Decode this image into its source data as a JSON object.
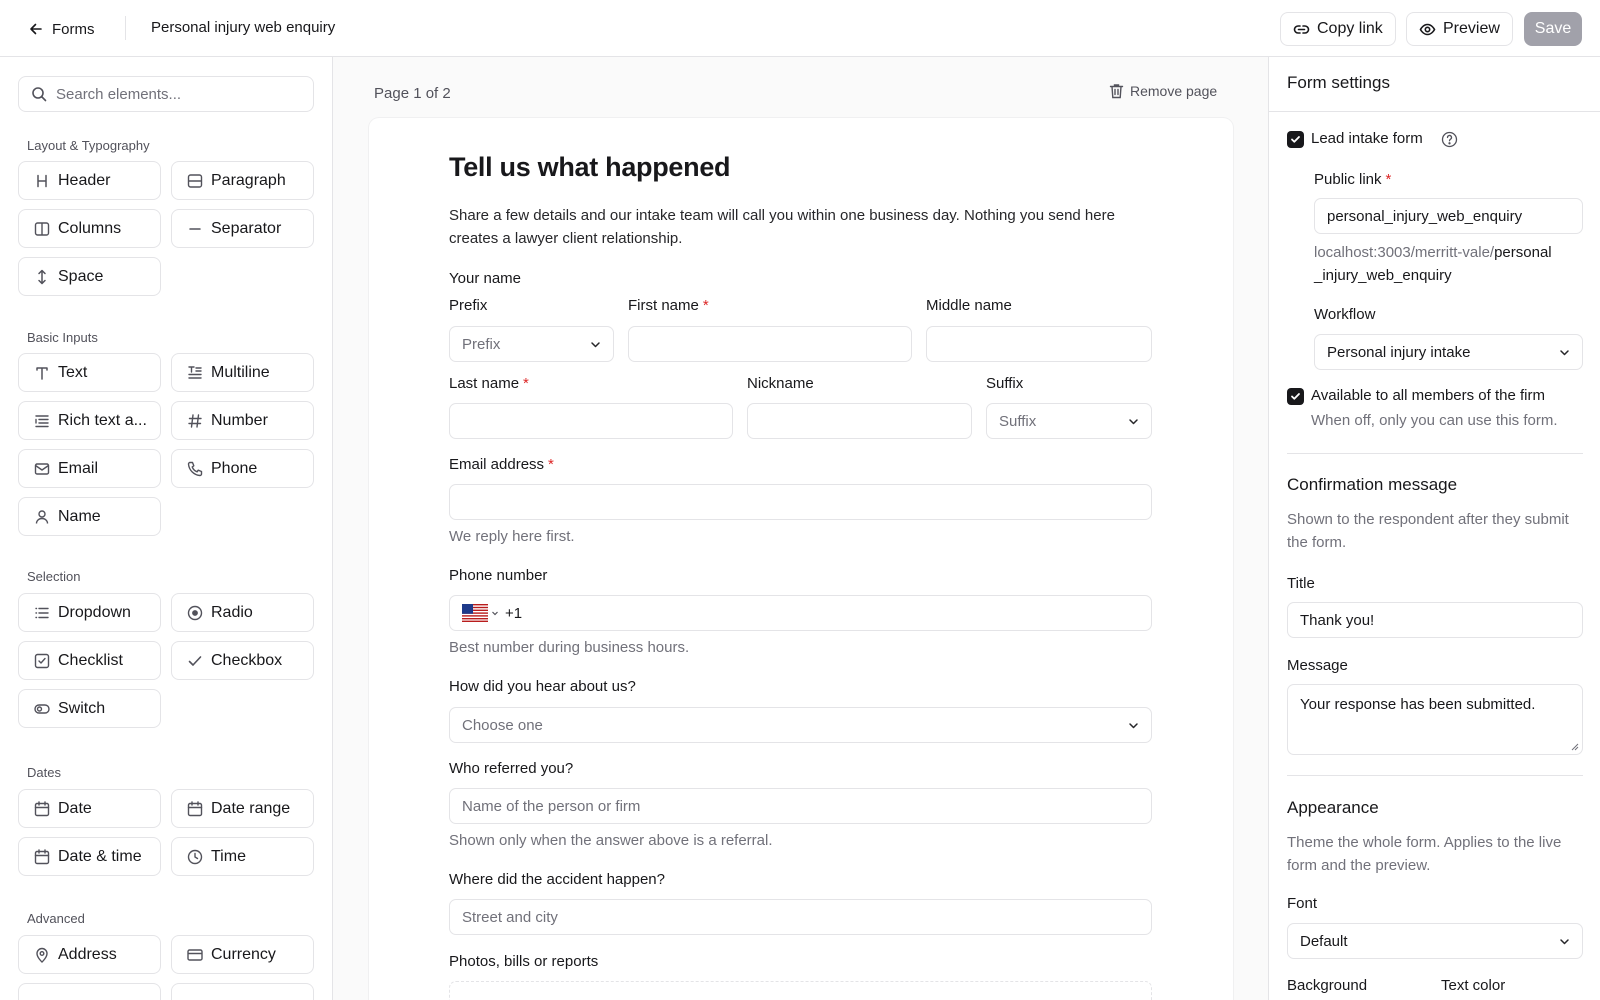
{
  "header": {
    "back_label": "Forms",
    "title": "Personal injury web enquiry",
    "copy_link_label": "Copy link",
    "preview_label": "Preview",
    "save_label": "Save"
  },
  "sidebar": {
    "search_placeholder": "Search elements...",
    "sections": {
      "layout": "Layout & Typography",
      "basic": "Basic Inputs",
      "selection": "Selection",
      "dates": "Dates",
      "advanced": "Advanced"
    },
    "elements": {
      "header": "Header",
      "paragraph": "Paragraph",
      "columns": "Columns",
      "separator": "Separator",
      "space": "Space",
      "text": "Text",
      "multiline": "Multiline",
      "rich_text": "Rich text a...",
      "number": "Number",
      "email": "Email",
      "phone": "Phone",
      "name": "Name",
      "dropdown": "Dropdown",
      "radio": "Radio",
      "checklist": "Checklist",
      "checkbox": "Checkbox",
      "switch": "Switch",
      "date": "Date",
      "date_range": "Date range",
      "date_time": "Date & time",
      "time": "Time",
      "address": "Address",
      "currency": "Currency"
    }
  },
  "canvas": {
    "page_indicator": "Page 1 of 2",
    "remove_page_label": "Remove page",
    "form": {
      "title": "Tell us what happened",
      "description": "Share a few details and our intake team will call you within one business day. Nothing you send here creates a lawyer client relationship.",
      "your_name_label": "Your name",
      "prefix_label": "Prefix",
      "prefix_placeholder": "Prefix",
      "first_name_label": "First name",
      "middle_name_label": "Middle name",
      "last_name_label": "Last name",
      "nickname_label": "Nickname",
      "suffix_label": "Suffix",
      "suffix_placeholder": "Suffix",
      "email_label": "Email address",
      "email_help": "We reply here first.",
      "phone_label": "Phone number",
      "phone_code": "+1",
      "phone_help": "Best number during business hours.",
      "hear_label": "How did you hear about us?",
      "hear_placeholder": "Choose one",
      "referred_label": "Who referred you?",
      "referred_placeholder": "Name of the person or firm",
      "referred_help": "Shown only when the answer above is a referral.",
      "accident_label": "Where did the accident happen?",
      "accident_placeholder": "Street and city",
      "photos_label": "Photos, bills or reports",
      "required_mark": "*"
    }
  },
  "settings": {
    "title": "Form settings",
    "lead_intake_label": "Lead intake form",
    "public_link_label": "Public link",
    "public_link_value": "personal_injury_web_enquiry",
    "link_base": "localhost:3003/merritt-vale/",
    "link_slug_part1": "personal",
    "link_slug_part2": "_injury_web_enquiry",
    "workflow_label": "Workflow",
    "workflow_value": "Personal injury intake",
    "available_label": "Available to all members of the firm",
    "available_help": "When off, only you can use this form.",
    "confirmation_title": "Confirmation message",
    "confirmation_desc": "Shown to the respondent after they submit the form.",
    "conf_title_label": "Title",
    "conf_title_value": "Thank you!",
    "message_label": "Message",
    "message_value": "Your response has been submitted.",
    "appearance_title": "Appearance",
    "appearance_desc": "Theme the whole form. Applies to the live form and the preview.",
    "font_label": "Font",
    "font_value": "Default",
    "background_label": "Background",
    "text_color_label": "Text color"
  }
}
